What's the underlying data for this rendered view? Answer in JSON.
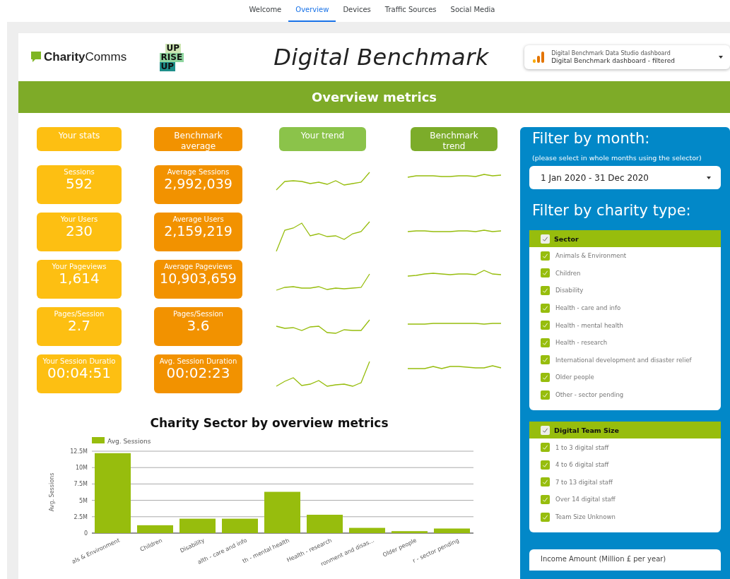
{
  "nav_tabs": [
    {
      "label": "Welcome",
      "selected": false
    },
    {
      "label": "Overview",
      "selected": true
    },
    {
      "label": "Devices",
      "selected": false
    },
    {
      "label": "Traffic Sources",
      "selected": false
    },
    {
      "label": "Social Media",
      "selected": false
    }
  ],
  "header": {
    "logo": "**Charity**Comms",
    "logo2": [
      "UP",
      "RISE",
      "UP"
    ],
    "title": "Digital Benchmark",
    "source": {
      "line1": "Digital Benchmark Data Studio dashboard",
      "line2": "Digital Benchmark dashboard - filtered"
    }
  },
  "banner": "Overview metrics",
  "column_headers": [
    {
      "label": "Your stats",
      "kind": "yours"
    },
    {
      "label": "Benchmark average",
      "kind": "benchmark"
    },
    {
      "label": "Your trend",
      "kind": "your-trend"
    },
    {
      "label": "Benchmark trend",
      "kind": "benchmark-trend"
    }
  ],
  "metrics": [
    {
      "your_label": "Sessions",
      "your_value": "592",
      "bench_label": "Average Sessions",
      "bench_value": "2,992,039"
    },
    {
      "your_label": "Your Users",
      "your_value": "230",
      "bench_label": "Average Users",
      "bench_value": "2,159,219"
    },
    {
      "your_label": "Your Pageviews",
      "your_value": "1,614",
      "bench_label": "Average Pageviews",
      "bench_value": "10,903,659"
    },
    {
      "your_label": "Pages/Session",
      "your_value": "2.7",
      "bench_label": "Pages/Session",
      "bench_value": "3.6"
    },
    {
      "your_label": "Your Session Duratio",
      "your_value": "00:04:51",
      "bench_label": "Avg. Session Duration",
      "bench_value": "00:02:23"
    }
  ],
  "chart": {
    "chart_data": {
      "type": "bar",
      "title": "Charity Sector by overview metrics",
      "ylabel": "Avg. Sessions",
      "categories": [
        "als & Environment",
        "Children",
        "Disability",
        "alth - care and info",
        "th - mental health",
        "Health - research",
        "ronment and disas...",
        "Older people",
        "r - sector pending"
      ],
      "series": [
        {
          "name": "Avg. Sessions",
          "color": "#97bd0d",
          "values": [
            12200000,
            1200000,
            2200000,
            2200000,
            6300000,
            2800000,
            800000,
            300000,
            700000
          ]
        }
      ],
      "ylim": [
        0,
        12500000
      ],
      "grid": true,
      "yticks": [
        {
          "value": 0,
          "label": "0"
        },
        {
          "value": 2500000,
          "label": "2.5M"
        },
        {
          "value": 5000000,
          "label": "5M"
        },
        {
          "value": 7500000,
          "label": "7.5M"
        },
        {
          "value": 10000000,
          "label": "10M"
        },
        {
          "value": 12500000,
          "label": "12.5M"
        }
      ]
    }
  },
  "filters": {
    "month_title": "Filter by month:",
    "month_hint": "(please select in whole months using the selector)",
    "date_range": "1 Jan 2020 - 31 Dec 2020",
    "type_title": "Filter by charity type:",
    "groups": [
      {
        "label": "Sector",
        "checked": true,
        "items": [
          {
            "label": "Animals & Environment",
            "checked": true
          },
          {
            "label": "Children",
            "checked": true
          },
          {
            "label": "Disability",
            "checked": true
          },
          {
            "label": "Health - care and info",
            "checked": true
          },
          {
            "label": "Health - mental health",
            "checked": true
          },
          {
            "label": "Health - research",
            "checked": true
          },
          {
            "label": "International development and disaster relief",
            "checked": true
          },
          {
            "label": "Older people",
            "checked": true
          },
          {
            "label": "Other - sector pending",
            "checked": true
          }
        ]
      },
      {
        "label": "Digital Team Size",
        "checked": true,
        "items": [
          {
            "label": "1 to 3 digital staff",
            "checked": true
          },
          {
            "label": "4 to 6 digital staff",
            "checked": true
          },
          {
            "label": "7 to 13 digital staff",
            "checked": true
          },
          {
            "label": "Over 14 digital staff",
            "checked": true
          },
          {
            "label": "Team Size Unknown",
            "checked": true
          }
        ]
      }
    ],
    "income_label": "Income Amount (Million £ per year)"
  }
}
